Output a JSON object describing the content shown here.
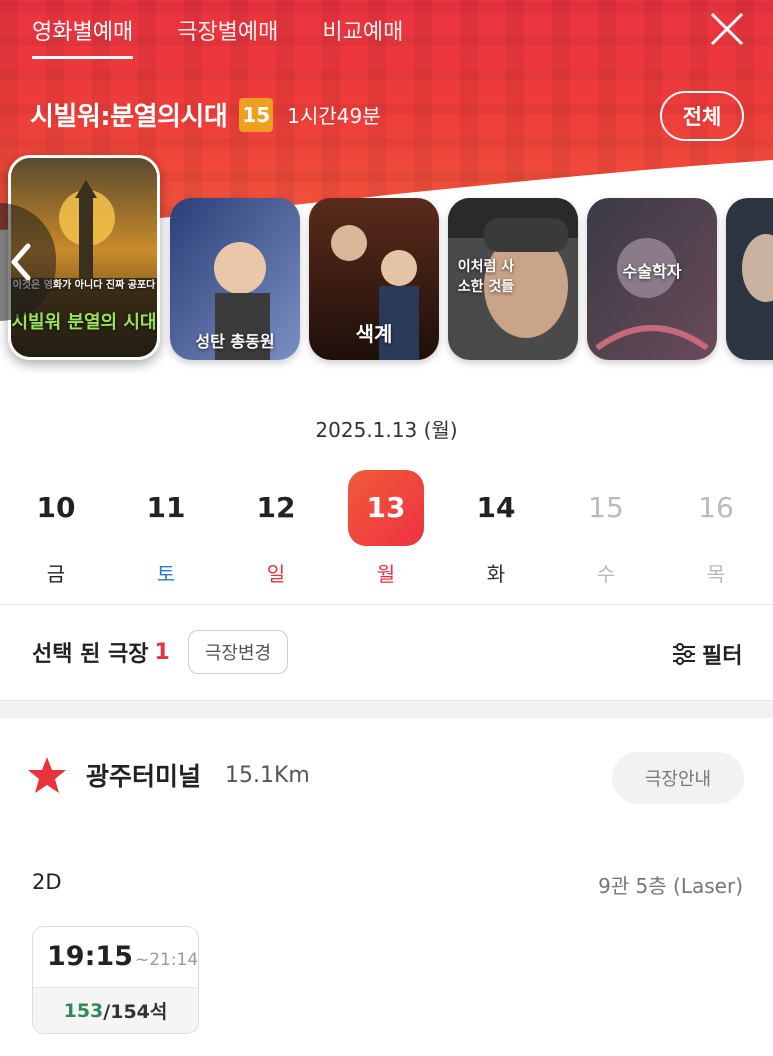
{
  "tabs": [
    "영화별예매",
    "극장별예매",
    "비교예매"
  ],
  "movie": {
    "title": "시빌워:분열의시대",
    "rating": "15",
    "runtime": "1시간49분"
  },
  "all_button": "전체",
  "posters": [
    {
      "tagline": "이것은 영화가 아니다 진짜 공포다",
      "title": "시빌워 분열의 시대",
      "selected": true
    },
    {
      "title": "성탄 총동원"
    },
    {
      "title": "색계"
    },
    {
      "title": "이처럼 사소한 것들"
    },
    {
      "title": "수술학자"
    },
    {
      "title": ""
    }
  ],
  "date_label": "2025.1.13 (월)",
  "days": [
    {
      "num": "10",
      "wd": "금",
      "wd_color": "#222222",
      "state": "normal"
    },
    {
      "num": "11",
      "wd": "토",
      "wd_color": "#2b7bd6",
      "state": "normal"
    },
    {
      "num": "12",
      "wd": "일",
      "wd_color": "#e8333f",
      "state": "normal"
    },
    {
      "num": "13",
      "wd": "월",
      "wd_color": "#e8333f",
      "state": "selected"
    },
    {
      "num": "14",
      "wd": "화",
      "wd_color": "#333333",
      "state": "normal"
    },
    {
      "num": "15",
      "wd": "수",
      "wd_color": "#bbbbbb",
      "state": "disabled"
    },
    {
      "num": "16",
      "wd": "목",
      "wd_color": "#bbbbbb",
      "state": "disabled"
    }
  ],
  "selection": {
    "label": "선택 된 극장",
    "count": "1",
    "change_button": "극장변경",
    "filter": "필터"
  },
  "theater": {
    "name": "광주터미널",
    "distance": "15.1Km",
    "info_button": "극장안내",
    "favorite": true
  },
  "showtime": {
    "format": "2D",
    "hall": "9관 5층 (Laser)",
    "start": "19:15",
    "end": "~21:14",
    "seats_available": "153",
    "seats_total": "/154석"
  },
  "colors": {
    "brand": "#e8333f",
    "rating": "#f0a020",
    "seats": "#2e8b57"
  }
}
